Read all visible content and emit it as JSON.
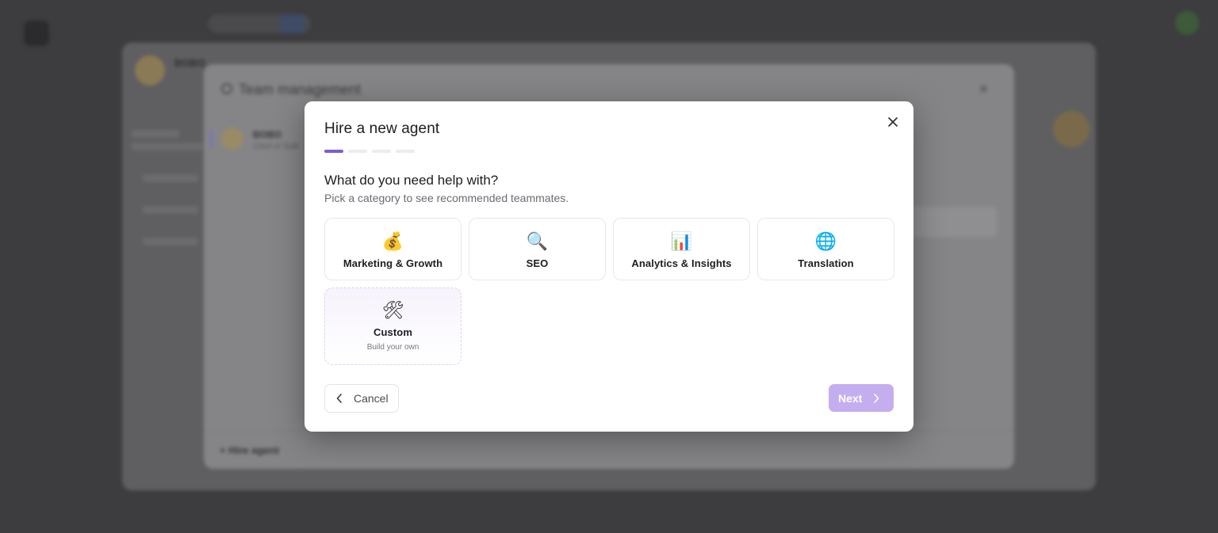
{
  "background": {
    "panel_name": "BOBO",
    "team_title": "Team management",
    "sidebar_name": "BOBO",
    "sidebar_role": "Chief of Staff",
    "hire_label": "+ Hire agent"
  },
  "modal": {
    "title": "Hire a new agent",
    "close_icon": "close-icon",
    "progress": {
      "current_step": 1,
      "total_steps": 4
    },
    "question": "What do you need help with?",
    "hint": "Pick a category to see recommended teammates.",
    "categories": [
      {
        "emoji": "💰",
        "label": "Marketing & Growth"
      },
      {
        "emoji": "🔍",
        "label": "SEO"
      },
      {
        "emoji": "📊",
        "label": "Analytics & Insights"
      },
      {
        "emoji": "🌐",
        "label": "Translation"
      }
    ],
    "custom": {
      "emoji": "🛠",
      "label": "Custom",
      "sub": "Build your own"
    },
    "cancel_label": "Cancel",
    "next_label": "Next"
  },
  "colors": {
    "accent": "#7c5cd6",
    "next_disabled": "#c4aef0"
  }
}
